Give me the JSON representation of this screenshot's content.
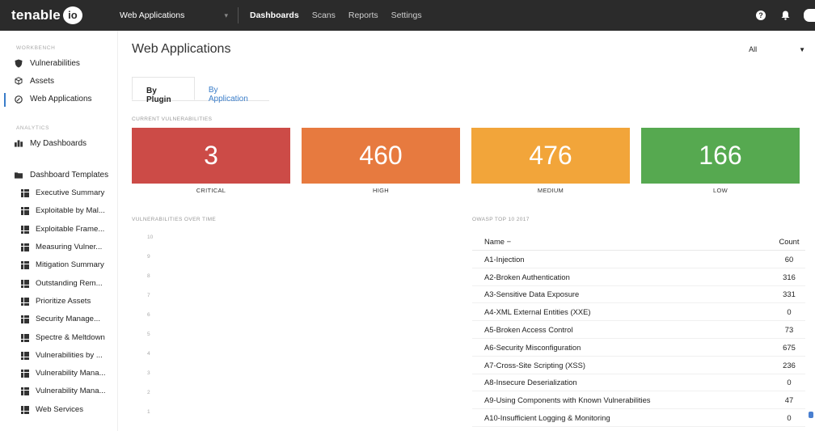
{
  "topbar": {
    "logo_text": "tenable",
    "logo_io": "io",
    "app_selector": "Web Applications",
    "nav": [
      "Dashboards",
      "Scans",
      "Reports",
      "Settings"
    ]
  },
  "sidebar": {
    "workbench_label": "WORKBENCH",
    "workbench_items": [
      "Vulnerabilities",
      "Assets",
      "Web Applications"
    ],
    "analytics_label": "ANALYTICS",
    "my_dashboards": "My Dashboards",
    "templates_label": "Dashboard Templates",
    "templates": [
      "Executive Summary",
      "Exploitable by Mal...",
      "Exploitable Frame...",
      "Measuring Vulner...",
      "Mitigation Summary",
      "Outstanding Rem...",
      "Prioritize Assets",
      "Security Manage...",
      "Spectre & Meltdown",
      "Vulnerabilities by ...",
      "Vulnerability Mana...",
      "Vulnerability Mana...",
      "Web Services"
    ]
  },
  "main": {
    "title": "Web Applications",
    "filter_value": "All",
    "tabs": [
      "By Plugin",
      "By Application"
    ],
    "current_vulns_label": "CURRENT VULNERABILITIES",
    "severity": [
      {
        "label": "CRITICAL",
        "value": "3",
        "color": "#cc4b47"
      },
      {
        "label": "HIGH",
        "value": "460",
        "color": "#e77a3f"
      },
      {
        "label": "MEDIUM",
        "value": "476",
        "color": "#f2a53a"
      },
      {
        "label": "LOW",
        "value": "166",
        "color": "#56a950"
      }
    ],
    "over_time_label": "VULNERABILITIES OVER TIME",
    "over_time_ticks": [
      "10",
      "9",
      "8",
      "7",
      "6",
      "5",
      "4",
      "3",
      "2",
      "1"
    ],
    "owasp_label": "OWASP TOP 10 2017",
    "owasp_header": {
      "name": "Name −",
      "count": "Count"
    },
    "owasp_rows": [
      {
        "name": "A1-Injection",
        "count": "60"
      },
      {
        "name": "A2-Broken Authentication",
        "count": "316"
      },
      {
        "name": "A3-Sensitive Data Exposure",
        "count": "331"
      },
      {
        "name": "A4-XML External Entities (XXE)",
        "count": "0"
      },
      {
        "name": "A5-Broken Access Control",
        "count": "73"
      },
      {
        "name": "A6-Security Misconfiguration",
        "count": "675"
      },
      {
        "name": "A7-Cross-Site Scripting (XSS)",
        "count": "236"
      },
      {
        "name": "A8-Insecure Deserialization",
        "count": "0"
      },
      {
        "name": "A9-Using Components with Known Vulnerabilities",
        "count": "47"
      },
      {
        "name": "A10-Insufficient Logging & Monitoring",
        "count": "0"
      }
    ]
  }
}
